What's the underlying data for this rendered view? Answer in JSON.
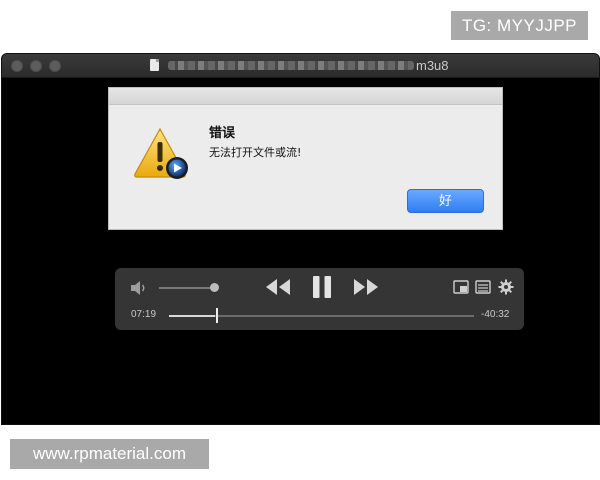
{
  "watermarks": {
    "top": "TG: MYYJJPP",
    "bottom": "www.rpmaterial.com"
  },
  "window": {
    "title_visible_suffix": "m3u8",
    "title_blurred": true
  },
  "dialog": {
    "title": "错误",
    "message": "无法打开文件或流!",
    "ok_label": "好",
    "icon": "warning-triangle-with-quicktime-icon"
  },
  "controls": {
    "elapsed": "07:19",
    "remaining": "-40:32",
    "progress_fraction": 0.15,
    "volume_fraction": 0.92,
    "icons": [
      "volume-icon",
      "rewind-icon",
      "pause-icon",
      "fast-forward-icon",
      "picture-in-picture-icon",
      "chapters-icon",
      "settings-gear-icon"
    ]
  },
  "colors": {
    "ok_button": "#2f7ef2",
    "warning": "#f2c230"
  }
}
